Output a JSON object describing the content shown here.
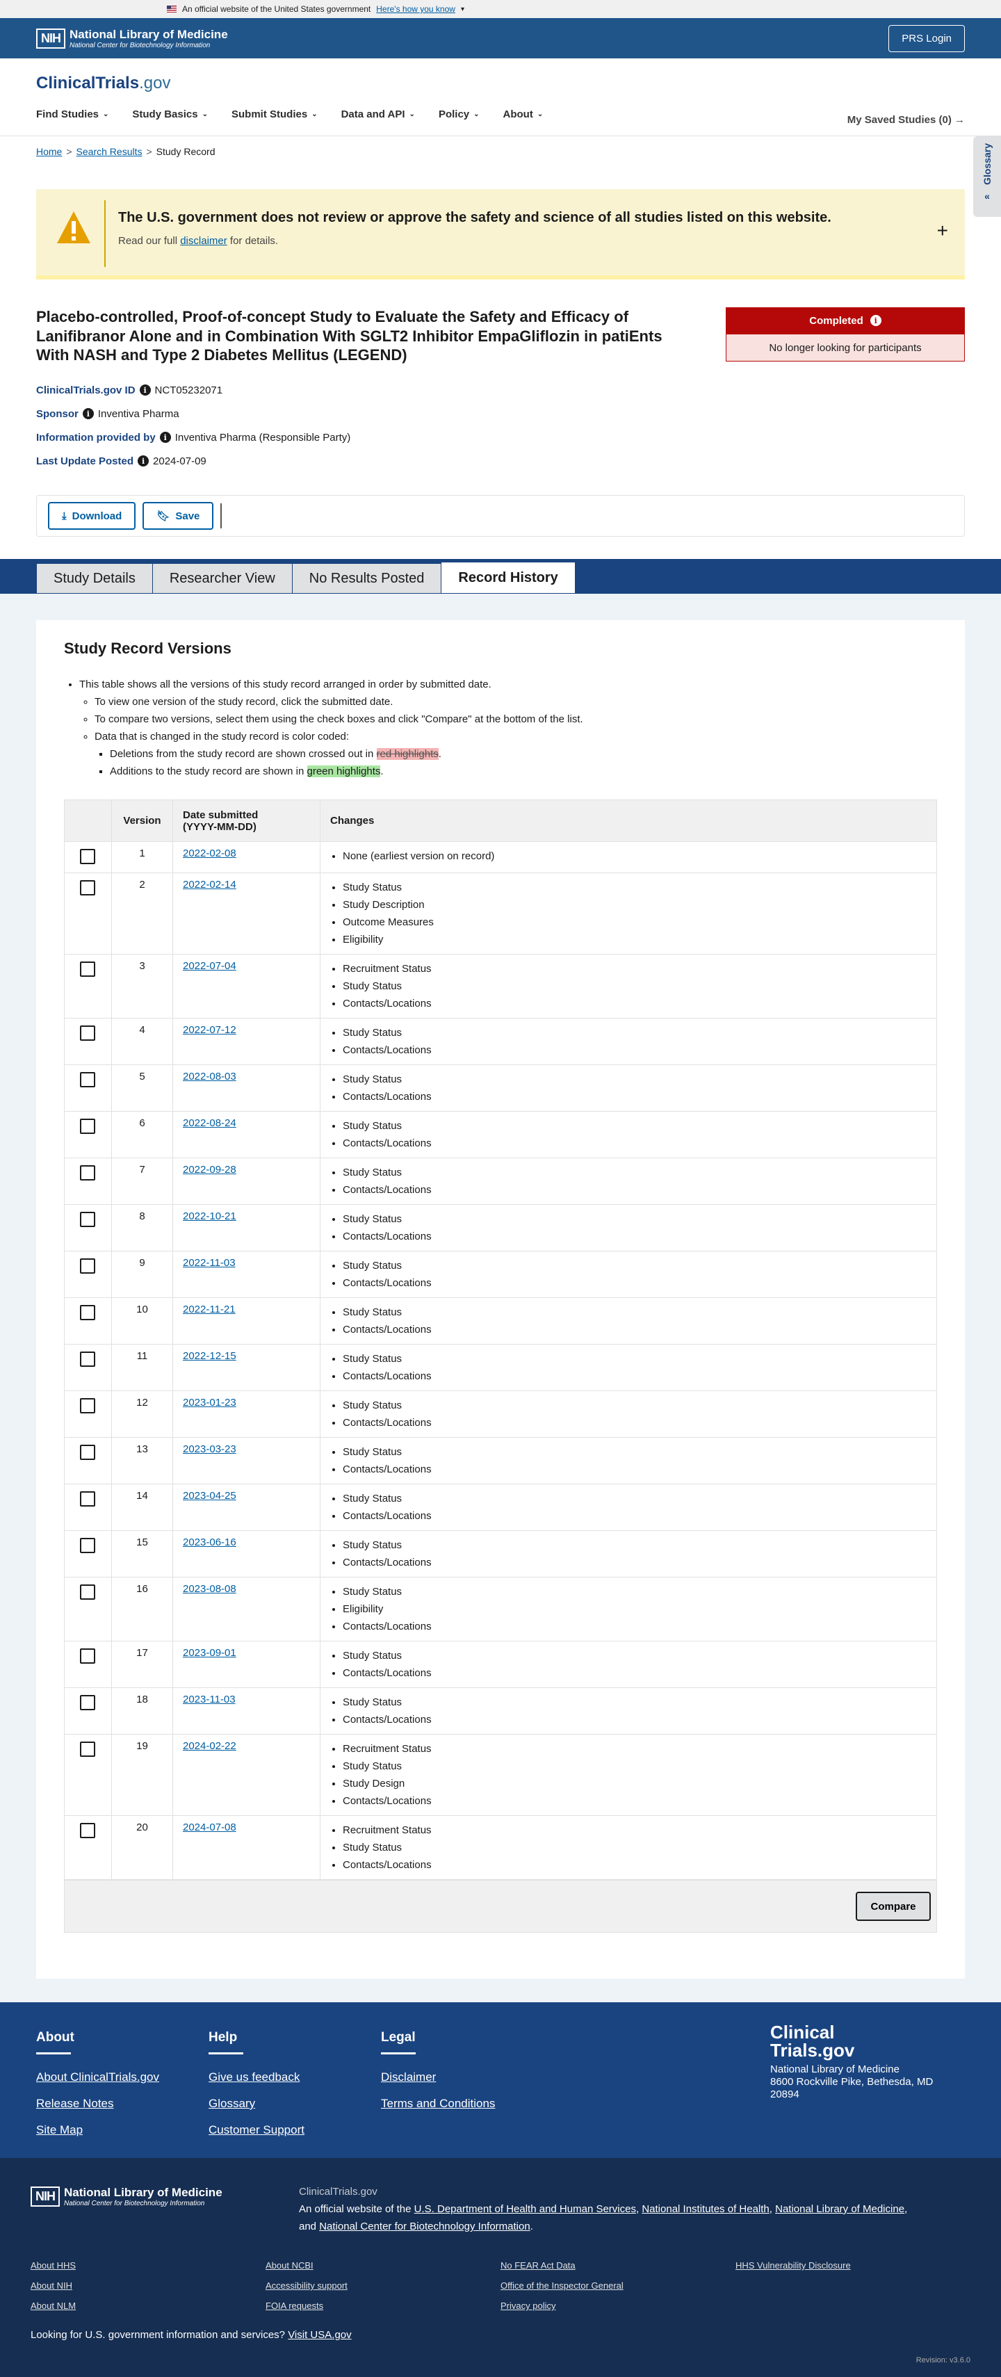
{
  "gov_banner": {
    "text": "An official website of the United States government",
    "link": "Here's how you know"
  },
  "nih": {
    "box": "NIH",
    "name": "National Library of Medicine",
    "sub": "National Center for Biotechnology Information",
    "prs_login": "PRS Login"
  },
  "header": {
    "logo_main": "ClinicalTrials",
    "logo_suffix": ".gov",
    "nav": [
      "Find Studies",
      "Study Basics",
      "Submit Studies",
      "Data and API",
      "Policy",
      "About"
    ],
    "saved": "My Saved Studies (0)"
  },
  "glossary": "Glossary",
  "breadcrumb": {
    "home": "Home",
    "search": "Search Results",
    "current": "Study Record"
  },
  "disclaimer": {
    "title": "The U.S. government does not review or approve the safety and science of all studies listed on this website.",
    "pre": "Read our full ",
    "link": "disclaimer",
    "post": " for details."
  },
  "study": {
    "title": "Placebo-controlled, Proof-of-concept Study to Evaluate the Safety and Efficacy of Lanifibranor Alone and in Combination With SGLT2 Inhibitor EmpaGliflozin in patiEnts With NASH and Type 2 Diabetes Mellitus (LEGEND)",
    "status": "Completed",
    "status_sub": "No longer looking for participants"
  },
  "info": [
    {
      "label": "ClinicalTrials.gov ID",
      "value": "NCT05232071"
    },
    {
      "label": "Sponsor",
      "value": "Inventiva Pharma"
    },
    {
      "label": "Information provided by",
      "value": "Inventiva Pharma (Responsible Party)"
    },
    {
      "label": "Last Update Posted",
      "value": "2024-07-09"
    }
  ],
  "actions": {
    "download": "Download",
    "save": "Save"
  },
  "tabs": [
    "Study Details",
    "Researcher View",
    "No Results Posted",
    "Record History"
  ],
  "versions_panel": {
    "title": "Study Record Versions",
    "b1": "This table shows all the versions of this study record arranged in order by submitted date.",
    "b2": "To view one version of the study record, click the submitted date.",
    "b3": "To compare two versions, select them using the check boxes and click \"Compare\" at the bottom of the list.",
    "b4": "Data that is changed in the study record is color coded:",
    "b5_pre": "Deletions from the study record are shown crossed out in ",
    "b5_hl": "red highlights",
    "b5_post": ".",
    "b6_pre": "Additions to the study record are shown in ",
    "b6_hl": "green highlights",
    "b6_post": ".",
    "col_version": "Version",
    "col_date": "Date submitted",
    "col_date2": "(YYYY-MM-DD)",
    "col_changes": "Changes",
    "compare": "Compare"
  },
  "rows": [
    {
      "v": "1",
      "d": "2022-02-08",
      "c": [
        "None (earliest version on record)"
      ]
    },
    {
      "v": "2",
      "d": "2022-02-14",
      "c": [
        "Study Status",
        "Study Description",
        "Outcome Measures",
        "Eligibility"
      ]
    },
    {
      "v": "3",
      "d": "2022-07-04",
      "c": [
        "Recruitment Status",
        "Study Status",
        "Contacts/Locations"
      ]
    },
    {
      "v": "4",
      "d": "2022-07-12",
      "c": [
        "Study Status",
        "Contacts/Locations"
      ]
    },
    {
      "v": "5",
      "d": "2022-08-03",
      "c": [
        "Study Status",
        "Contacts/Locations"
      ]
    },
    {
      "v": "6",
      "d": "2022-08-24",
      "c": [
        "Study Status",
        "Contacts/Locations"
      ]
    },
    {
      "v": "7",
      "d": "2022-09-28",
      "c": [
        "Study Status",
        "Contacts/Locations"
      ]
    },
    {
      "v": "8",
      "d": "2022-10-21",
      "c": [
        "Study Status",
        "Contacts/Locations"
      ]
    },
    {
      "v": "9",
      "d": "2022-11-03",
      "c": [
        "Study Status",
        "Contacts/Locations"
      ]
    },
    {
      "v": "10",
      "d": "2022-11-21",
      "c": [
        "Study Status",
        "Contacts/Locations"
      ]
    },
    {
      "v": "11",
      "d": "2022-12-15",
      "c": [
        "Study Status",
        "Contacts/Locations"
      ]
    },
    {
      "v": "12",
      "d": "2023-01-23",
      "c": [
        "Study Status",
        "Contacts/Locations"
      ]
    },
    {
      "v": "13",
      "d": "2023-03-23",
      "c": [
        "Study Status",
        "Contacts/Locations"
      ]
    },
    {
      "v": "14",
      "d": "2023-04-25",
      "c": [
        "Study Status",
        "Contacts/Locations"
      ]
    },
    {
      "v": "15",
      "d": "2023-06-16",
      "c": [
        "Study Status",
        "Contacts/Locations"
      ]
    },
    {
      "v": "16",
      "d": "2023-08-08",
      "c": [
        "Study Status",
        "Eligibility",
        "Contacts/Locations"
      ]
    },
    {
      "v": "17",
      "d": "2023-09-01",
      "c": [
        "Study Status",
        "Contacts/Locations"
      ]
    },
    {
      "v": "18",
      "d": "2023-11-03",
      "c": [
        "Study Status",
        "Contacts/Locations"
      ]
    },
    {
      "v": "19",
      "d": "2024-02-22",
      "c": [
        "Recruitment Status",
        "Study Status",
        "Study Design",
        "Contacts/Locations"
      ]
    },
    {
      "v": "20",
      "d": "2024-07-08",
      "c": [
        "Recruitment Status",
        "Study Status",
        "Contacts/Locations"
      ]
    }
  ],
  "footer": {
    "about": {
      "title": "About",
      "links": [
        "About ClinicalTrials.gov",
        "Release Notes",
        "Site Map"
      ]
    },
    "help": {
      "title": "Help",
      "links": [
        "Give us feedback",
        "Glossary",
        "Customer Support"
      ]
    },
    "legal": {
      "title": "Legal",
      "links": [
        "Disclaimer",
        "Terms and Conditions"
      ]
    },
    "brand": {
      "l1": "Clinical",
      "l2": "Trials.gov",
      "a1": "National Library of Medicine",
      "a2": "8600 Rockville Pike, Bethesda, MD",
      "a3": "20894"
    }
  },
  "nih_footer": {
    "site": "ClinicalTrials.gov",
    "d_pre": "An official website of the ",
    "d_l1": "U.S. Department of Health and Human Services",
    "d_s1": ", ",
    "d_l2": "National Institutes of Health",
    "d_s2": ", ",
    "d_l3": "National Library of Medicine",
    "d_s3": ",",
    "d_and": "and ",
    "d_l4": "National Center for Biotechnology Information",
    "d_end": ".",
    "c1": [
      "About HHS",
      "About NIH",
      "About NLM"
    ],
    "c2": [
      "About NCBI",
      "Accessibility support",
      "FOIA requests"
    ],
    "c3": [
      "No FEAR Act Data",
      "Office of the Inspector General",
      "Privacy policy"
    ],
    "c4": [
      "HHS Vulnerability Disclosure"
    ],
    "gov_q": "Looking for U.S. government information and services?",
    "gov_link": "Visit USA.gov",
    "revision": "Revision: v3.6.0"
  }
}
